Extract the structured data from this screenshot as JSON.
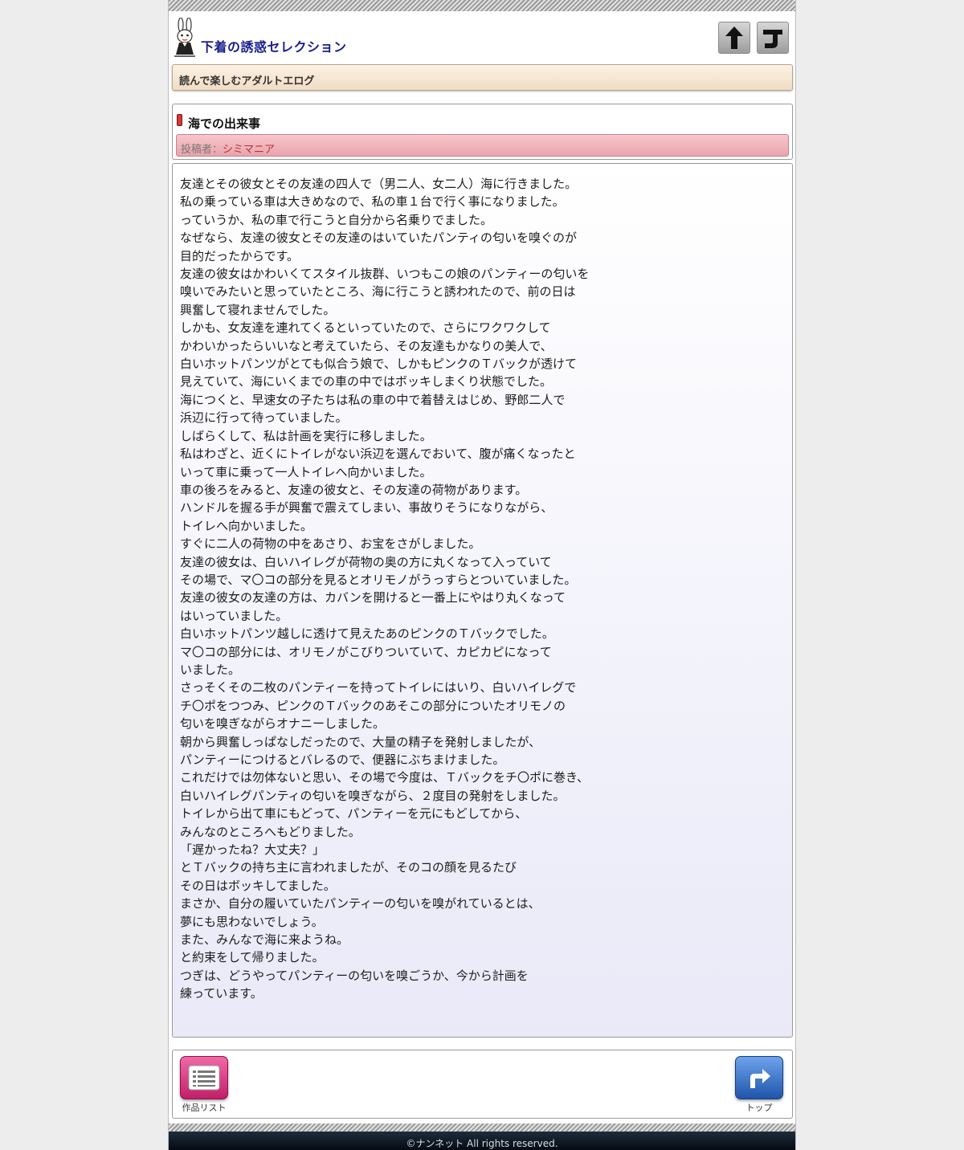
{
  "header": {
    "site_title": "下着の誘惑セレクション",
    "tagline": "読んで楽しむアダルトエログ"
  },
  "post": {
    "title": "海での出来事",
    "author_label": "投稿者：",
    "author_name": "シミマニア",
    "lines": [
      "友達とその彼女とその友達の四人で（男二人、女二人）海に行きました。",
      "私の乗っている車は大きめなので、私の車１台で行く事になりました。",
      "っていうか、私の車で行こうと自分から名乗りでました。",
      "なぜなら、友達の彼女とその友達のはいていたパンティの匂いを嗅ぐのが",
      "目的だったからです。",
      "友達の彼女はかわいくてスタイル抜群、いつもこの娘のパンティーの匂いを",
      "嗅いでみたいと思っていたところ、海に行こうと誘われたので、前の日は",
      "興奮して寝れませんでした。",
      "しかも、女友達を連れてくるといっていたので、さらにワクワクして",
      "かわいかったらいいなと考えていたら、その友達もかなりの美人で、",
      "白いホットパンツがとても似合う娘で、しかもピンクのＴバックが透けて",
      "見えていて、海にいくまでの車の中ではボッキしまくり状態でした。",
      "海につくと、早速女の子たちは私の車の中で着替えはじめ、野郎二人で",
      "浜辺に行って待っていました。",
      "しばらくして、私は計画を実行に移しました。",
      "私はわざと、近くにトイレがない浜辺を選んでおいて、腹が痛くなったと",
      "いって車に乗って一人トイレへ向かいました。",
      "車の後ろをみると、友達の彼女と、その友達の荷物があります。",
      "ハンドルを握る手が興奮で震えてしまい、事故りそうになりながら、",
      "トイレへ向かいました。",
      "すぐに二人の荷物の中をあさり、お宝をさがしました。",
      "友達の彼女は、白いハイレグが荷物の奥の方に丸くなって入っていて",
      "その場で、マ〇コの部分を見るとオリモノがうっすらとついていました。",
      "友達の彼女の友達の方は、カバンを開けると一番上にやはり丸くなって",
      "はいっていました。",
      "白いホットパンツ越しに透けて見えたあのピンクのＴバックでした。",
      "マ〇コの部分には、オリモノがこびりついていて、カピカピになって",
      "いました。",
      "さっそくその二枚のパンティーを持ってトイレにはいり、白いハイレグで",
      "チ〇ポをつつみ、ピンクのＴバックのあそこの部分についたオリモノの",
      "匂いを嗅ぎながらオナニーしました。",
      "朝から興奮しっぱなしだったので、大量の精子を発射しましたが、",
      "パンティーにつけるとバレるので、便器にぶちまけました。",
      "これだけでは勿体ないと思い、その場で今度は、Ｔバックをチ〇ポに巻き、",
      "白いハイレグパンティの匂いを嗅ぎながら、２度目の発射をしました。",
      "トイレから出て車にもどって、パンティーを元にもどしてから、",
      "みんなのところへもどりました。",
      "「遅かったね？大丈夫？」",
      "とＴバックの持ち主に言われましたが、そのコの顔を見るたび",
      "その日はボッキしてました。",
      "まさか、自分の履いていたパンティーの匂いを嗅がれているとは、",
      "夢にも思わないでしょう。",
      "また、みんなで海に来ようね。",
      "と約束をして帰りました。",
      "つぎは、どうやってパンティーの匂いを嗅ごうか、今から計画を",
      "練っています。"
    ]
  },
  "footer_nav": {
    "list_label": "作品リスト",
    "top_label": "トップ"
  },
  "copyright": "©ナンネット All rights reserved.",
  "icons": {
    "logo": "rabbit-mascot-icon",
    "scroll_top": "up-arrow-icon",
    "return": "return-arrow-icon",
    "list": "list-icon",
    "top": "turn-right-arrow-icon"
  },
  "colors": {
    "title_text": "#1a1f8e",
    "author_bar": "#f2b8bf",
    "author_name": "#b2323c",
    "tagline_bar": "#f5e5d1",
    "list_button": "#d8347c",
    "top_button": "#2a63b8",
    "copyright_bar": "#111a26"
  }
}
